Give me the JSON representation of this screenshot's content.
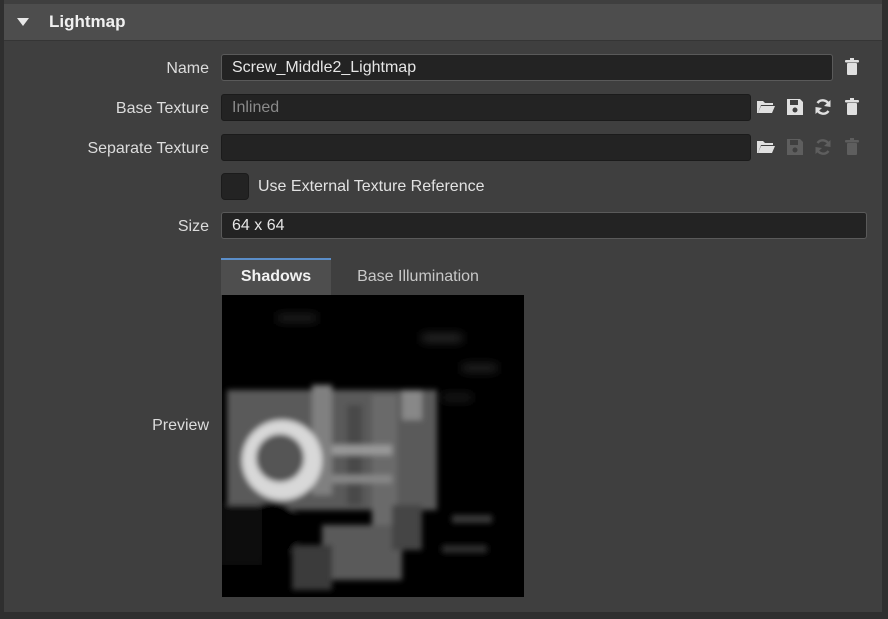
{
  "section": {
    "title": "Lightmap"
  },
  "fields": {
    "name": {
      "label": "Name",
      "value": "Screw_Middle2_Lightmap"
    },
    "base_texture": {
      "label": "Base Texture",
      "placeholder": "Inlined"
    },
    "separate_texture": {
      "label": "Separate Texture",
      "value": ""
    },
    "use_external": {
      "label": "Use External Texture Reference",
      "checked": false
    },
    "size": {
      "label": "Size",
      "value": "64 x 64"
    },
    "preview": {
      "label": "Preview"
    }
  },
  "tabs": [
    {
      "label": "Shadows",
      "active": true
    },
    {
      "label": "Base Illumination",
      "active": false
    }
  ],
  "icons": {
    "name_row": [
      "trash-icon"
    ],
    "base_texture_row": [
      "folder-open-icon",
      "save-icon",
      "refresh-icon",
      "trash-icon"
    ],
    "separate_texture_row": [
      "folder-open-icon",
      "save-icon",
      "refresh-icon",
      "trash-icon"
    ]
  },
  "colors": {
    "accent": "#5b8ec9",
    "icon_enabled": "#e0e0e0",
    "icon_disabled": "#5e5e5e"
  }
}
